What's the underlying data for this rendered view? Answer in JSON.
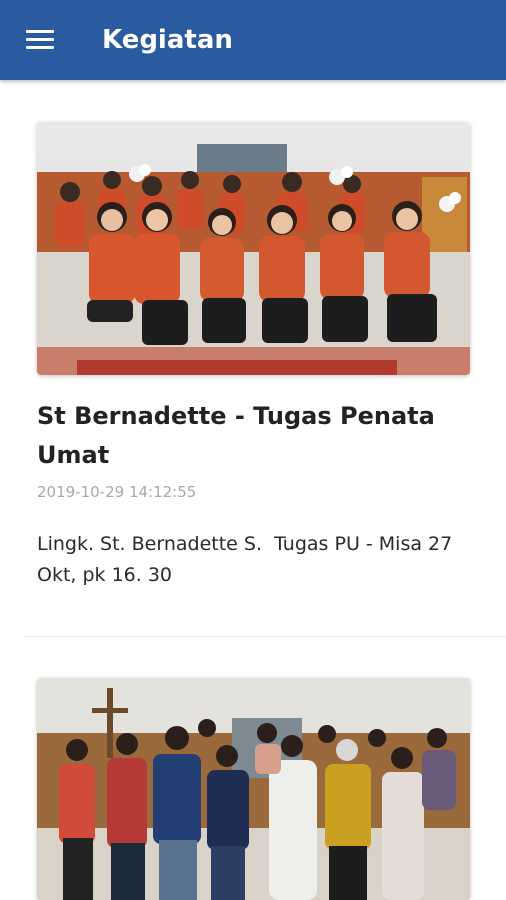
{
  "appbar": {
    "title": "Kegiatan",
    "menu_icon": "hamburger-menu-icon",
    "background_color": "#2a5aa0"
  },
  "posts": [
    {
      "title": "St Bernadette - Tugas Penata Umat",
      "date": "2019-10-29 14:12:55",
      "description": "Lingk. St. Bernadette S.  Tugas PU - Misa 27 Okt, pk 16. 30"
    }
  ]
}
